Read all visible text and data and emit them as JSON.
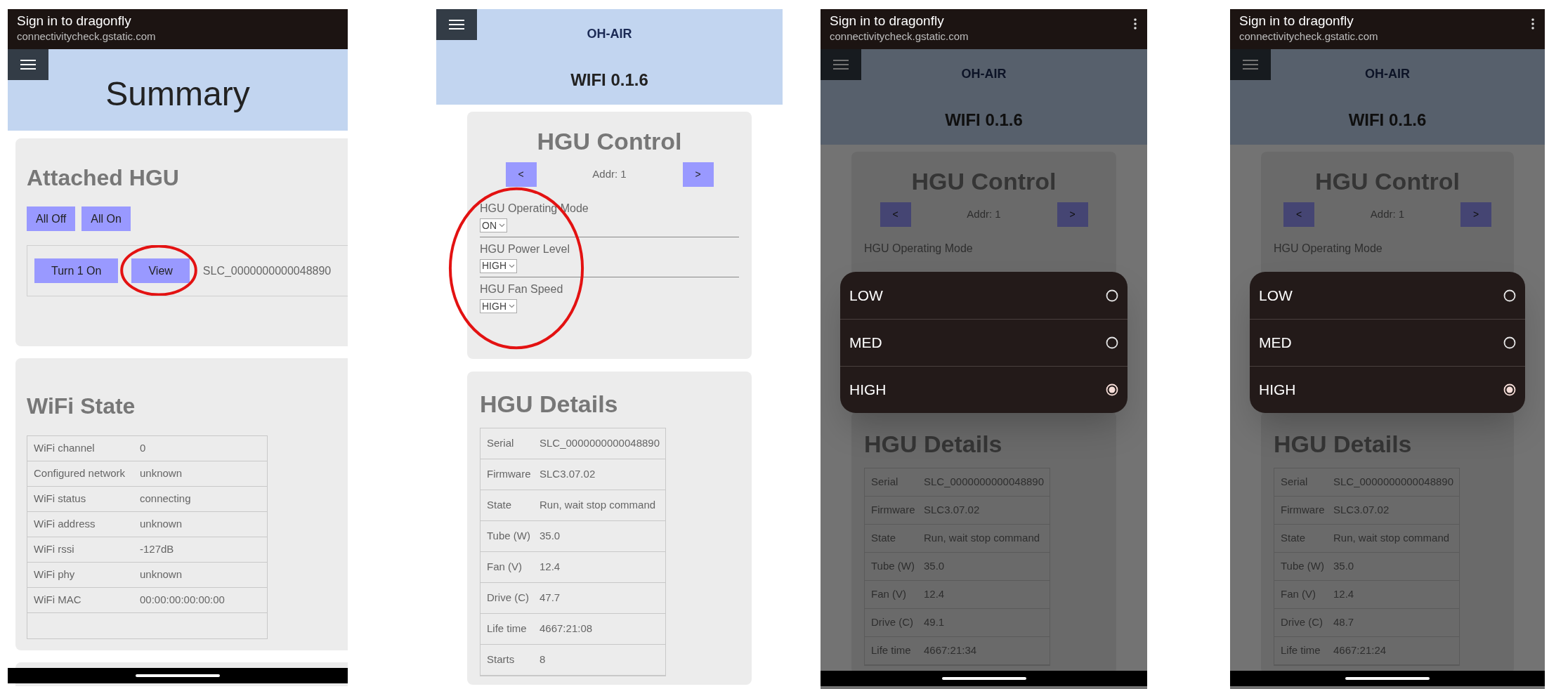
{
  "screens": [
    {
      "kind": "summary",
      "browser_bar": {
        "title": "Sign in to dragonfly",
        "url": "connectivitycheck.gstatic.com",
        "menu": false
      },
      "header": {
        "title": "Summary"
      },
      "attached": {
        "title": "Attached HGU",
        "buttons": [
          "All Off",
          "All On"
        ],
        "row": {
          "buttons": [
            {
              "label": "Turn 1 On",
              "circled": false
            },
            {
              "label": "View",
              "circled": true
            }
          ],
          "serial": "SLC_0000000000048890"
        }
      },
      "wifi": {
        "title": "WiFi State",
        "rows": [
          {
            "label": "WiFi channel",
            "value": "0"
          },
          {
            "label": "Configured network",
            "value": "unknown"
          },
          {
            "label": "WiFi status",
            "value": "connecting"
          },
          {
            "label": "WiFi address",
            "value": "unknown"
          },
          {
            "label": "WiFi rssi",
            "value": "-127dB"
          },
          {
            "label": "WiFi phy",
            "value": "unknown"
          },
          {
            "label": "WiFi MAC",
            "value": "00:00:00:00:00:00"
          }
        ]
      },
      "home_bar": true
    },
    {
      "kind": "control",
      "header": {
        "app": "OH-AIR",
        "version": "WIFI 0.1.6"
      },
      "control": {
        "title": "HGU Control",
        "prev": "<",
        "addr": "Addr: 1",
        "next": ">",
        "circled": true,
        "fields": [
          {
            "label": "HGU Operating Mode",
            "value": "ON"
          },
          {
            "label": "HGU Power Level",
            "value": "HIGH"
          },
          {
            "label": "HGU Fan Speed",
            "value": "HIGH"
          }
        ]
      },
      "details": {
        "title": "HGU Details",
        "rows": [
          {
            "label": "Serial",
            "value": "SLC_0000000000048890"
          },
          {
            "label": "Firmware",
            "value": "SLC3.07.02"
          },
          {
            "label": "State",
            "value": "Run, wait stop command"
          },
          {
            "label": "Tube (W)",
            "value": "35.0"
          },
          {
            "label": "Fan (V)",
            "value": "12.4"
          },
          {
            "label": "Drive (C)",
            "value": "47.7"
          },
          {
            "label": "Life time",
            "value": "4667:21:08"
          },
          {
            "label": "Starts",
            "value": "8"
          }
        ]
      },
      "home_bar": false
    },
    {
      "kind": "control",
      "browser_bar": {
        "title": "Sign in to dragonfly",
        "url": "connectivitycheck.gstatic.com",
        "menu": true
      },
      "header": {
        "app": "OH-AIR",
        "version": "WIFI 0.1.6"
      },
      "control": {
        "title": "HGU Control",
        "prev": "<",
        "addr": "Addr: 1",
        "next": ">",
        "circled": false,
        "fields": [
          {
            "label": "HGU Operating Mode"
          }
        ]
      },
      "details": {
        "title": "HGU Details",
        "rows": [
          {
            "label": "Serial",
            "value": "SLC_0000000000048890"
          },
          {
            "label": "Firmware",
            "value": "SLC3.07.02"
          },
          {
            "label": "State",
            "value": "Run, wait stop command"
          },
          {
            "label": "Tube (W)",
            "value": "35.0"
          },
          {
            "label": "Fan (V)",
            "value": "12.4"
          },
          {
            "label": "Drive (C)",
            "value": "49.1"
          },
          {
            "label": "Life time",
            "value": "4667:21:34"
          }
        ]
      },
      "picker": {
        "options": [
          {
            "label": "LOW",
            "selected": false
          },
          {
            "label": "MED",
            "selected": false
          },
          {
            "label": "HIGH",
            "selected": true
          }
        ]
      },
      "home_bar": true
    },
    {
      "kind": "control",
      "browser_bar": {
        "title": "Sign in to dragonfly",
        "url": "connectivitycheck.gstatic.com",
        "menu": true
      },
      "header": {
        "app": "OH-AIR",
        "version": "WIFI 0.1.6"
      },
      "control": {
        "title": "HGU Control",
        "prev": "<",
        "addr": "Addr: 1",
        "next": ">",
        "circled": false,
        "fields": [
          {
            "label": "HGU Operating Mode"
          }
        ]
      },
      "details": {
        "title": "HGU Details",
        "rows": [
          {
            "label": "Serial",
            "value": "SLC_0000000000048890"
          },
          {
            "label": "Firmware",
            "value": "SLC3.07.02"
          },
          {
            "label": "State",
            "value": "Run, wait stop command"
          },
          {
            "label": "Tube (W)",
            "value": "35.0"
          },
          {
            "label": "Fan (V)",
            "value": "12.4"
          },
          {
            "label": "Drive (C)",
            "value": "48.7"
          },
          {
            "label": "Life time",
            "value": "4667:21:24"
          }
        ]
      },
      "picker": {
        "options": [
          {
            "label": "LOW",
            "selected": false
          },
          {
            "label": "MED",
            "selected": false
          },
          {
            "label": "HIGH",
            "selected": true
          }
        ]
      },
      "home_bar": true
    }
  ]
}
